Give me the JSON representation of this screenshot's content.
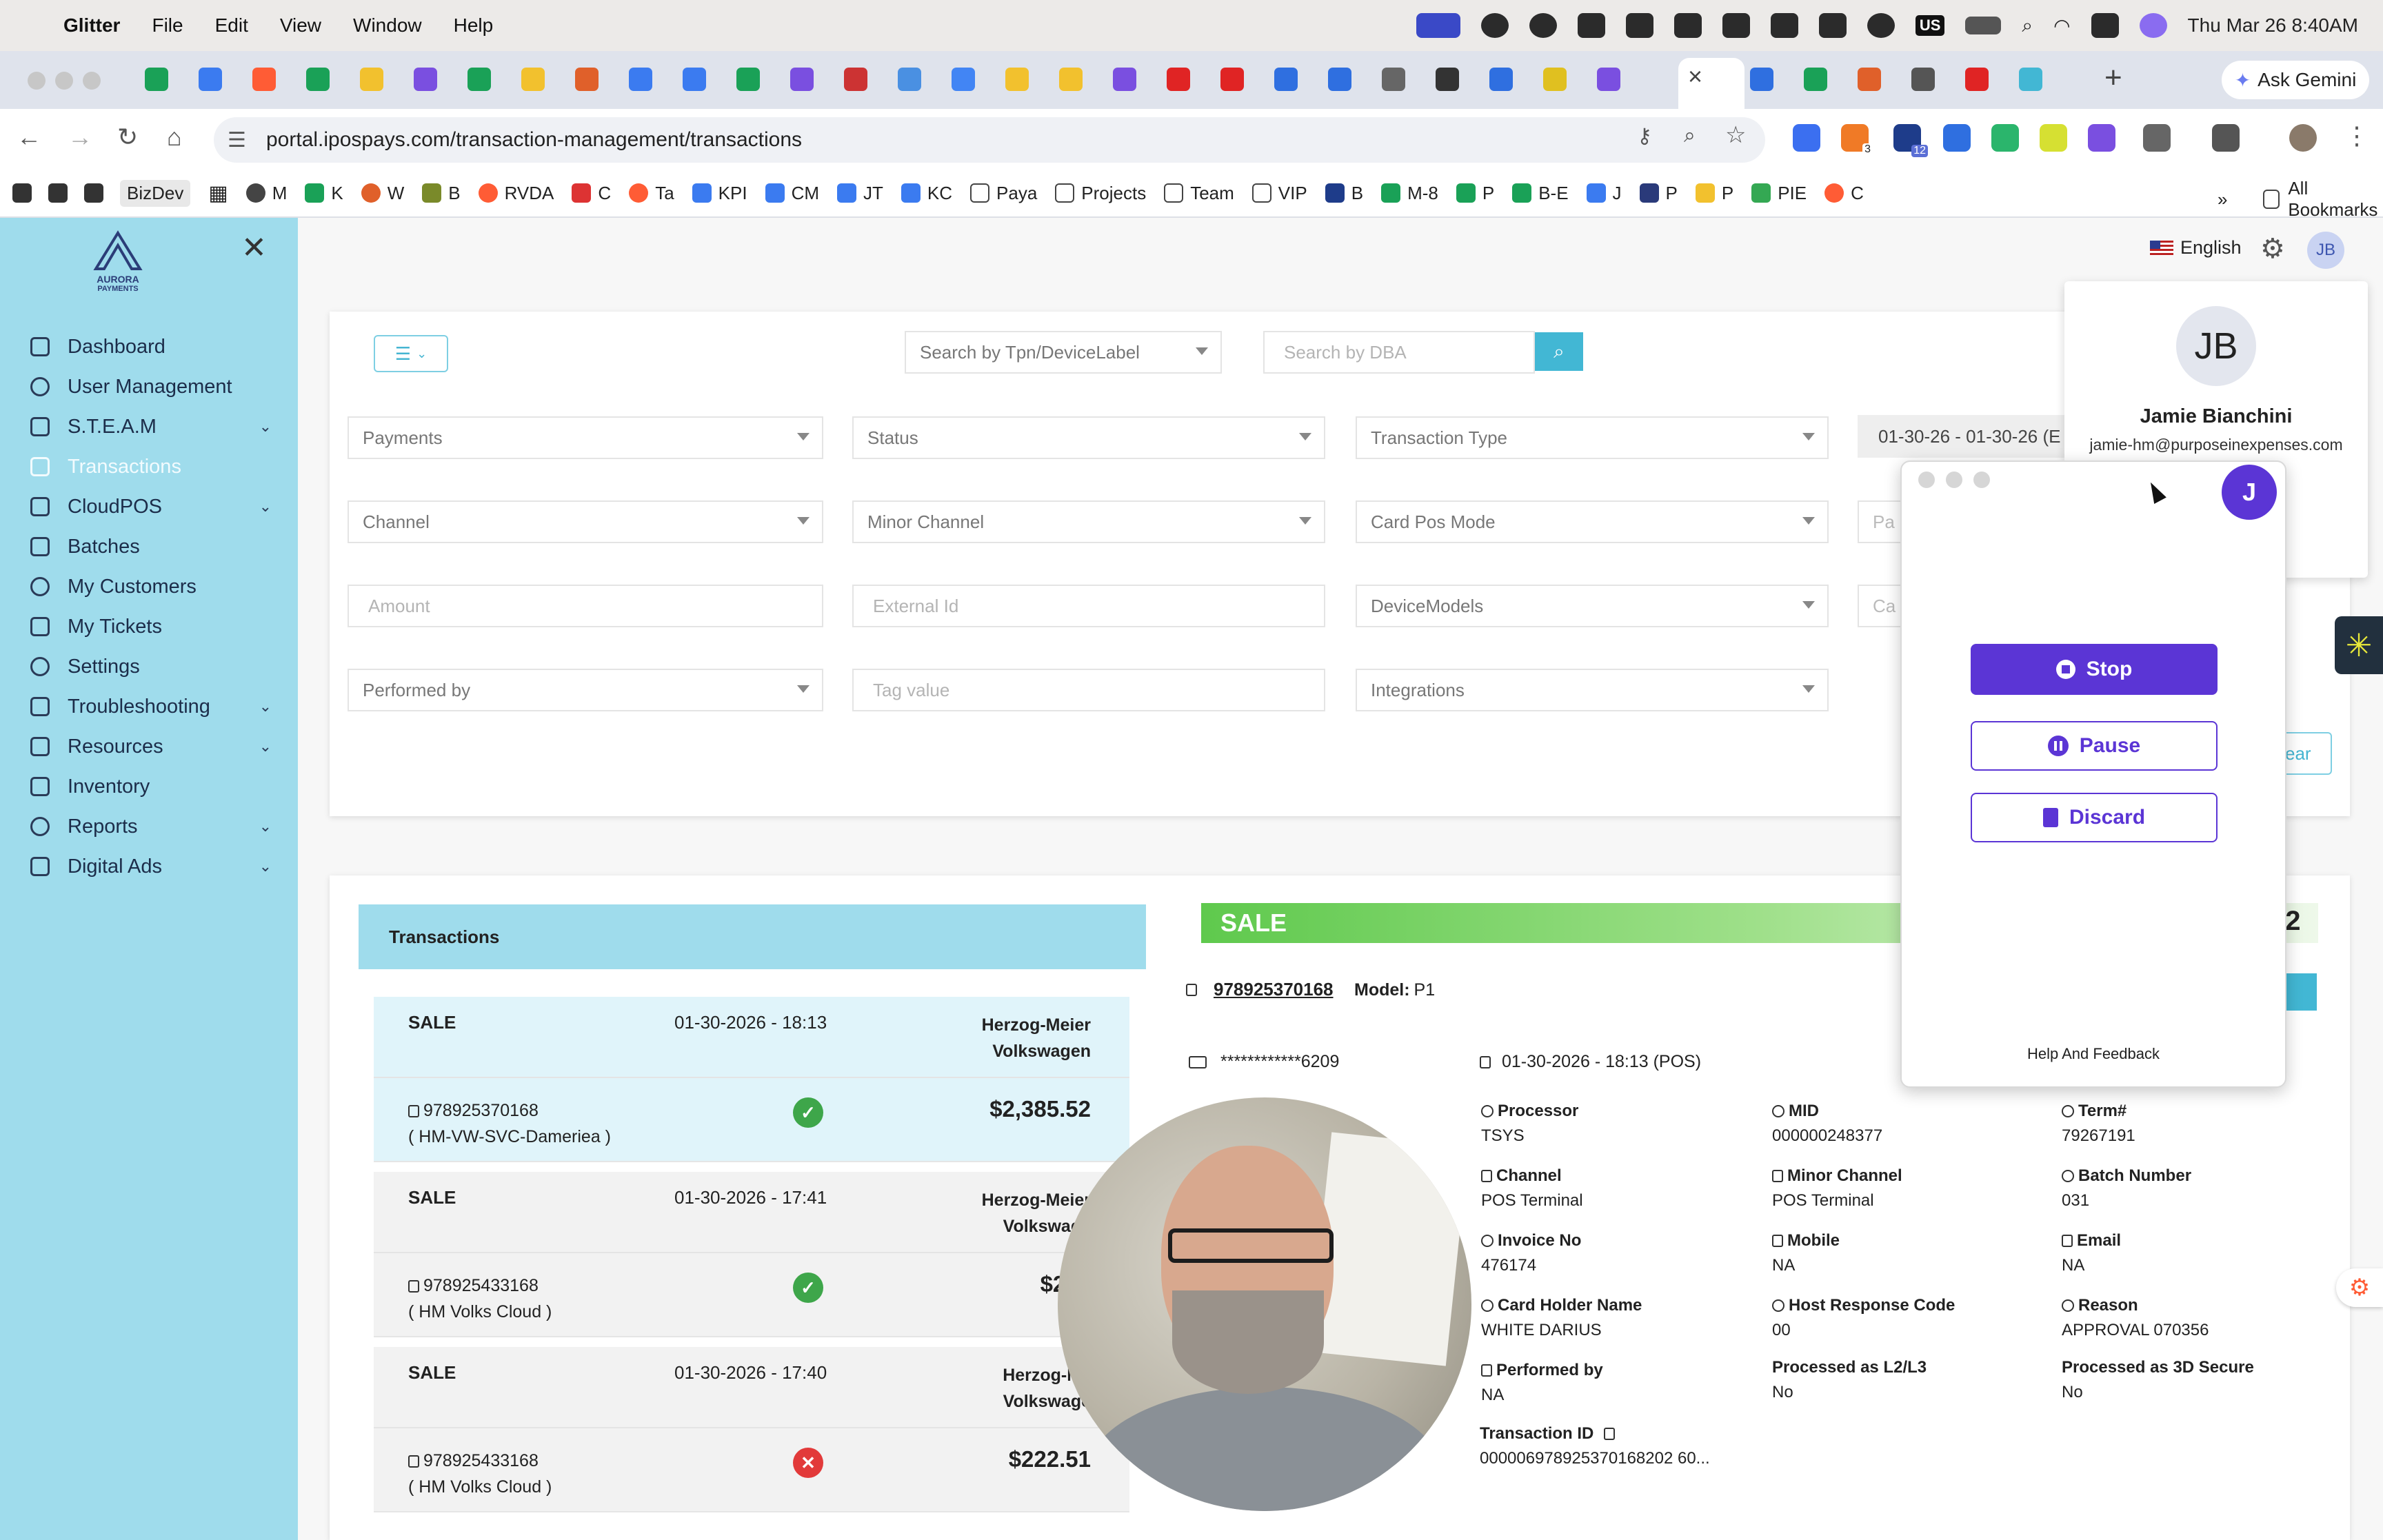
{
  "menubar": {
    "app": "Glitter",
    "items": [
      "File",
      "Edit",
      "View",
      "Window",
      "Help"
    ],
    "clock": "Thu Mar 26  8:40AM",
    "tray_label": "US"
  },
  "browser": {
    "url": "portal.ipospays.com/transaction-management/transactions",
    "ask_gemini": "Ask Gemini",
    "extension_badge_1": "3",
    "extension_badge_2": "12",
    "bookmarks": [
      "BizDev",
      "M",
      "K",
      "W",
      "B",
      "RVDA",
      "C",
      "Ta",
      "KPI",
      "CM",
      "JT",
      "KC",
      "Paya",
      "Projects",
      "Team",
      "VIP",
      "B",
      "M-8",
      "P",
      "B-E",
      "J",
      "P",
      "P",
      "PIE",
      "C"
    ],
    "all_bookmarks": "All Bookmarks"
  },
  "sidebar": {
    "logo_text": "AURORA",
    "logo_sub": "PAYMENTS",
    "items": [
      {
        "label": "Dashboard"
      },
      {
        "label": "User Management"
      },
      {
        "label": "S.T.E.A.M"
      },
      {
        "label": "Transactions"
      },
      {
        "label": "CloudPOS"
      },
      {
        "label": "Batches"
      },
      {
        "label": "My Customers"
      },
      {
        "label": "My Tickets"
      },
      {
        "label": "Settings"
      },
      {
        "label": "Troubleshooting"
      },
      {
        "label": "Resources"
      },
      {
        "label": "Inventory"
      },
      {
        "label": "Reports"
      },
      {
        "label": "Digital Ads"
      }
    ]
  },
  "header": {
    "language": "English",
    "avatar_initials": "JB"
  },
  "profile": {
    "initials": "JB",
    "name": "Jamie Bianchini",
    "email": "jamie-hm@purposeinexpenses.com"
  },
  "filters": {
    "search_tpn_placeholder": "Search by Tpn/DeviceLabel",
    "search_dba_placeholder": "Search by DBA",
    "payments": "Payments",
    "status": "Status",
    "transaction_type": "Transaction Type",
    "date_range": "01-30-26 - 01-30-26 (E",
    "channel": "Channel",
    "minor_channel": "Minor Channel",
    "card_pos_mode": "Card Pos Mode",
    "partial_col4_row2": "Pa",
    "amount_placeholder": "Amount",
    "external_id_placeholder": "External Id",
    "device_models": "DeviceModels",
    "partial_col4_row3": "Ca",
    "performed_by": "Performed by",
    "tag_value_placeholder": "Tag value",
    "integrations": "Integrations",
    "clear_partial": "ear"
  },
  "transactions": {
    "header": "Transactions",
    "rows": [
      {
        "type": "SALE",
        "date": "01-30-2026 - 18:13",
        "merchant": "Herzog-Meier Volkswagen",
        "tpn": "978925370168",
        "device": "( HM-VW-SVC-Dameriea )",
        "amount": "$2,385.52",
        "status": "success"
      },
      {
        "type": "SALE",
        "date": "01-30-2026 - 17:41",
        "merchant": "Herzog-Meier Volkswage",
        "tpn": "978925433168",
        "device": "( HM Volks Cloud )",
        "amount": "$222",
        "status": "success"
      },
      {
        "type": "SALE",
        "date": "01-30-2026 - 17:40",
        "merchant": "Herzog-Me Volkswage",
        "tpn": "978925433168",
        "device": "( HM Volks Cloud )",
        "amount": "$222.51",
        "status": "failed"
      }
    ]
  },
  "detail": {
    "type": "SALE",
    "amount_partial": "52",
    "tpn": "978925370168",
    "model_label": "Model:",
    "model": "P1",
    "card": "************6209",
    "datetime": "01-30-2026 - 18:13 (POS)",
    "fields": {
      "processor": {
        "label": "Processor",
        "value": "TSYS"
      },
      "mid": {
        "label": "MID",
        "value": "000000248377"
      },
      "term": {
        "label": "Term#",
        "value": "79267191"
      },
      "channel": {
        "label": "Channel",
        "value": "POS Terminal"
      },
      "minor_channel": {
        "label": "Minor Channel",
        "value": "POS Terminal"
      },
      "batch": {
        "label": "Batch Number",
        "value": "031"
      },
      "invoice": {
        "label": "Invoice No",
        "value": "476174"
      },
      "mobile": {
        "label": "Mobile",
        "value": "NA"
      },
      "email": {
        "label": "Email",
        "value": "NA"
      },
      "cardholder": {
        "label": "Card Holder Name",
        "value": "WHITE DARIUS"
      },
      "host_code": {
        "label": "Host Response Code",
        "value": "00"
      },
      "reason": {
        "label": "Reason",
        "value": "APPROVAL 070356"
      },
      "performed_by": {
        "label": "Performed by",
        "value": "NA"
      },
      "l2l3": {
        "label": "Processed as L2/L3",
        "value": "No"
      },
      "secure3d": {
        "label": "Processed as 3D Secure",
        "value": "No"
      },
      "transaction_id": {
        "label": "Transaction ID",
        "value": "000006978925370168202 60..."
      }
    }
  },
  "recorder": {
    "avatar": "J",
    "stop": "Stop",
    "pause": "Pause",
    "discard": "Discard",
    "help": "Help And Feedback"
  },
  "colors": {
    "sidebar": "#9fdcec",
    "accent": "#42b7d4",
    "recorder_purple": "#5b35d5",
    "success": "#3ea64a",
    "danger": "#e23a3a"
  }
}
